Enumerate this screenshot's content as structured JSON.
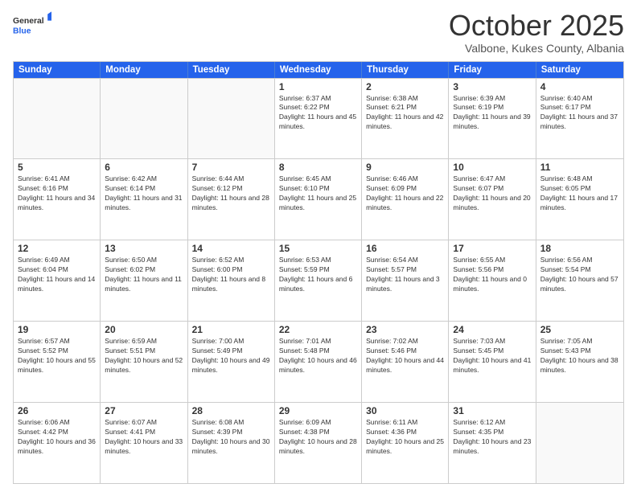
{
  "logo": {
    "general": "General",
    "blue": "Blue"
  },
  "title": "October 2025",
  "location": "Valbone, Kukes County, Albania",
  "days_of_week": [
    "Sunday",
    "Monday",
    "Tuesday",
    "Wednesday",
    "Thursday",
    "Friday",
    "Saturday"
  ],
  "weeks": [
    [
      {
        "day": "",
        "sunrise": "",
        "sunset": "",
        "daylight": "",
        "empty": true
      },
      {
        "day": "",
        "sunrise": "",
        "sunset": "",
        "daylight": "",
        "empty": true
      },
      {
        "day": "",
        "sunrise": "",
        "sunset": "",
        "daylight": "",
        "empty": true
      },
      {
        "day": "1",
        "sunrise": "Sunrise: 6:37 AM",
        "sunset": "Sunset: 6:22 PM",
        "daylight": "Daylight: 11 hours and 45 minutes."
      },
      {
        "day": "2",
        "sunrise": "Sunrise: 6:38 AM",
        "sunset": "Sunset: 6:21 PM",
        "daylight": "Daylight: 11 hours and 42 minutes."
      },
      {
        "day": "3",
        "sunrise": "Sunrise: 6:39 AM",
        "sunset": "Sunset: 6:19 PM",
        "daylight": "Daylight: 11 hours and 39 minutes."
      },
      {
        "day": "4",
        "sunrise": "Sunrise: 6:40 AM",
        "sunset": "Sunset: 6:17 PM",
        "daylight": "Daylight: 11 hours and 37 minutes."
      }
    ],
    [
      {
        "day": "5",
        "sunrise": "Sunrise: 6:41 AM",
        "sunset": "Sunset: 6:16 PM",
        "daylight": "Daylight: 11 hours and 34 minutes."
      },
      {
        "day": "6",
        "sunrise": "Sunrise: 6:42 AM",
        "sunset": "Sunset: 6:14 PM",
        "daylight": "Daylight: 11 hours and 31 minutes."
      },
      {
        "day": "7",
        "sunrise": "Sunrise: 6:44 AM",
        "sunset": "Sunset: 6:12 PM",
        "daylight": "Daylight: 11 hours and 28 minutes."
      },
      {
        "day": "8",
        "sunrise": "Sunrise: 6:45 AM",
        "sunset": "Sunset: 6:10 PM",
        "daylight": "Daylight: 11 hours and 25 minutes."
      },
      {
        "day": "9",
        "sunrise": "Sunrise: 6:46 AM",
        "sunset": "Sunset: 6:09 PM",
        "daylight": "Daylight: 11 hours and 22 minutes."
      },
      {
        "day": "10",
        "sunrise": "Sunrise: 6:47 AM",
        "sunset": "Sunset: 6:07 PM",
        "daylight": "Daylight: 11 hours and 20 minutes."
      },
      {
        "day": "11",
        "sunrise": "Sunrise: 6:48 AM",
        "sunset": "Sunset: 6:05 PM",
        "daylight": "Daylight: 11 hours and 17 minutes."
      }
    ],
    [
      {
        "day": "12",
        "sunrise": "Sunrise: 6:49 AM",
        "sunset": "Sunset: 6:04 PM",
        "daylight": "Daylight: 11 hours and 14 minutes."
      },
      {
        "day": "13",
        "sunrise": "Sunrise: 6:50 AM",
        "sunset": "Sunset: 6:02 PM",
        "daylight": "Daylight: 11 hours and 11 minutes."
      },
      {
        "day": "14",
        "sunrise": "Sunrise: 6:52 AM",
        "sunset": "Sunset: 6:00 PM",
        "daylight": "Daylight: 11 hours and 8 minutes."
      },
      {
        "day": "15",
        "sunrise": "Sunrise: 6:53 AM",
        "sunset": "Sunset: 5:59 PM",
        "daylight": "Daylight: 11 hours and 6 minutes."
      },
      {
        "day": "16",
        "sunrise": "Sunrise: 6:54 AM",
        "sunset": "Sunset: 5:57 PM",
        "daylight": "Daylight: 11 hours and 3 minutes."
      },
      {
        "day": "17",
        "sunrise": "Sunrise: 6:55 AM",
        "sunset": "Sunset: 5:56 PM",
        "daylight": "Daylight: 11 hours and 0 minutes."
      },
      {
        "day": "18",
        "sunrise": "Sunrise: 6:56 AM",
        "sunset": "Sunset: 5:54 PM",
        "daylight": "Daylight: 10 hours and 57 minutes."
      }
    ],
    [
      {
        "day": "19",
        "sunrise": "Sunrise: 6:57 AM",
        "sunset": "Sunset: 5:52 PM",
        "daylight": "Daylight: 10 hours and 55 minutes."
      },
      {
        "day": "20",
        "sunrise": "Sunrise: 6:59 AM",
        "sunset": "Sunset: 5:51 PM",
        "daylight": "Daylight: 10 hours and 52 minutes."
      },
      {
        "day": "21",
        "sunrise": "Sunrise: 7:00 AM",
        "sunset": "Sunset: 5:49 PM",
        "daylight": "Daylight: 10 hours and 49 minutes."
      },
      {
        "day": "22",
        "sunrise": "Sunrise: 7:01 AM",
        "sunset": "Sunset: 5:48 PM",
        "daylight": "Daylight: 10 hours and 46 minutes."
      },
      {
        "day": "23",
        "sunrise": "Sunrise: 7:02 AM",
        "sunset": "Sunset: 5:46 PM",
        "daylight": "Daylight: 10 hours and 44 minutes."
      },
      {
        "day": "24",
        "sunrise": "Sunrise: 7:03 AM",
        "sunset": "Sunset: 5:45 PM",
        "daylight": "Daylight: 10 hours and 41 minutes."
      },
      {
        "day": "25",
        "sunrise": "Sunrise: 7:05 AM",
        "sunset": "Sunset: 5:43 PM",
        "daylight": "Daylight: 10 hours and 38 minutes."
      }
    ],
    [
      {
        "day": "26",
        "sunrise": "Sunrise: 6:06 AM",
        "sunset": "Sunset: 4:42 PM",
        "daylight": "Daylight: 10 hours and 36 minutes."
      },
      {
        "day": "27",
        "sunrise": "Sunrise: 6:07 AM",
        "sunset": "Sunset: 4:41 PM",
        "daylight": "Daylight: 10 hours and 33 minutes."
      },
      {
        "day": "28",
        "sunrise": "Sunrise: 6:08 AM",
        "sunset": "Sunset: 4:39 PM",
        "daylight": "Daylight: 10 hours and 30 minutes."
      },
      {
        "day": "29",
        "sunrise": "Sunrise: 6:09 AM",
        "sunset": "Sunset: 4:38 PM",
        "daylight": "Daylight: 10 hours and 28 minutes."
      },
      {
        "day": "30",
        "sunrise": "Sunrise: 6:11 AM",
        "sunset": "Sunset: 4:36 PM",
        "daylight": "Daylight: 10 hours and 25 minutes."
      },
      {
        "day": "31",
        "sunrise": "Sunrise: 6:12 AM",
        "sunset": "Sunset: 4:35 PM",
        "daylight": "Daylight: 10 hours and 23 minutes."
      },
      {
        "day": "",
        "sunrise": "",
        "sunset": "",
        "daylight": "",
        "empty": true
      }
    ]
  ]
}
